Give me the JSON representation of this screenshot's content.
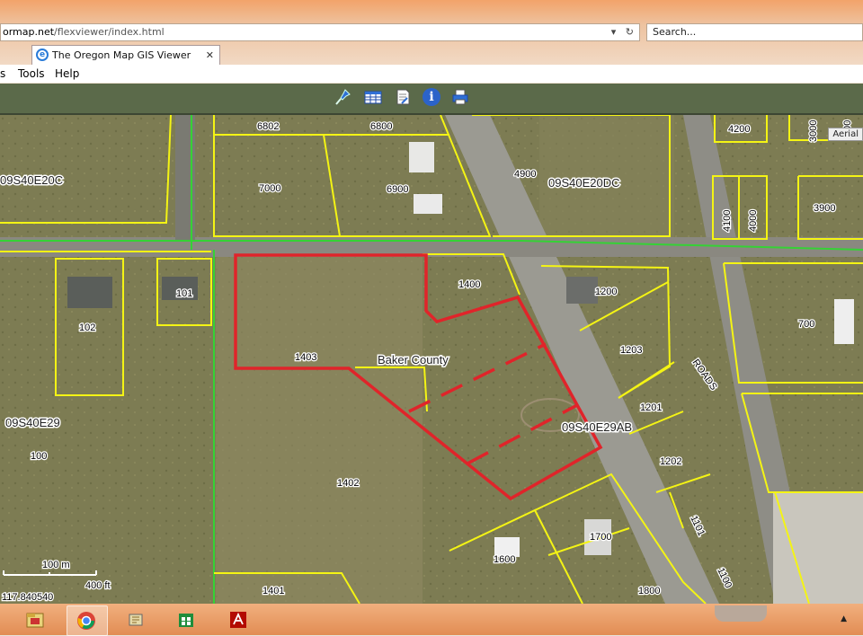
{
  "browser": {
    "address": "ormap.net/flexviewer/index.html",
    "address_host": "ormap.net",
    "address_path": "/flexviewer/index.html",
    "address_dropdown": "▾",
    "address_refresh": "↻",
    "search_placeholder": "Search...",
    "tab_title": "The Oregon Map GIS Viewer",
    "tab_close": "✕",
    "menu": [
      "s",
      "Tools",
      "Help"
    ]
  },
  "toolbar": {
    "icons": [
      "pushpin-icon",
      "table-icon",
      "note-icon",
      "info-icon",
      "print-icon"
    ]
  },
  "map": {
    "aerial_label": "Aerial",
    "section_labels": [
      "09S40E20C",
      "09S40E20DC",
      "09S40E29",
      "09S40E29AB"
    ],
    "parcel_numbers": [
      "6802",
      "6800",
      "4900",
      "4200",
      "7000",
      "6900",
      "4100",
      "4000",
      "3900",
      "1400",
      "1200",
      "102",
      "101",
      "700",
      "1403",
      "1203",
      "1201",
      "100",
      "1202",
      "1402",
      "1700",
      "1101",
      "1600",
      "1401",
      "1800",
      "1100",
      "3000",
      "300"
    ],
    "county_label": "Baker County",
    "road_label": "ROADS",
    "scale_metric": "100 m",
    "scale_imperial": "400 ft",
    "coordinate": "117.840540"
  },
  "taskbar": {
    "apps": [
      "file-manager",
      "chrome",
      "media",
      "store",
      "acrobat"
    ]
  },
  "colors": {
    "parcel_line": "#f4f414",
    "section_line": "#35d235",
    "highlight": "#e0242a",
    "toolbar_bg": "#5b6a4a"
  }
}
